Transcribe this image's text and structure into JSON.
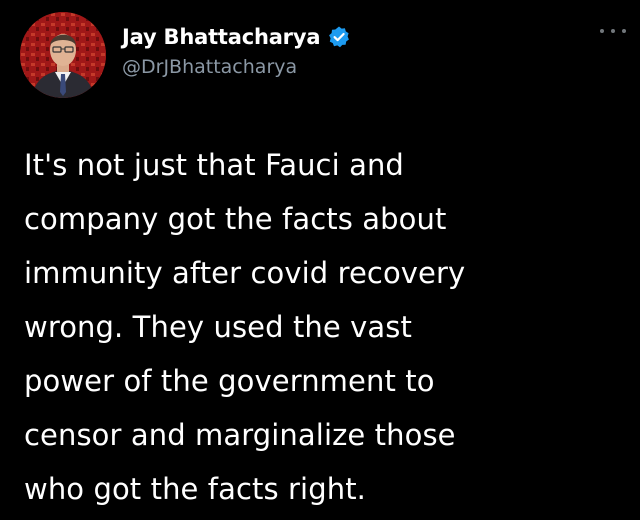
{
  "tweet": {
    "author": {
      "display_name": "Jay Bhattacharya",
      "handle": "@DrJBhattacharya",
      "verified": true,
      "avatar_icon": "profile-photo"
    },
    "more_icon": "more-options-icon",
    "text": "It's not just that Fauci and\ncompany got the facts about\nimmunity after covid recovery\nwrong.  They used the vast\npower of the government to\ncensor and marginalize those\nwho got the facts right."
  },
  "colors": {
    "background": "#000000",
    "text": "#ffffff",
    "secondary_text": "#8b98a5",
    "verified_badge": "#1d9bf0",
    "avatar_background": "#8a1414"
  }
}
